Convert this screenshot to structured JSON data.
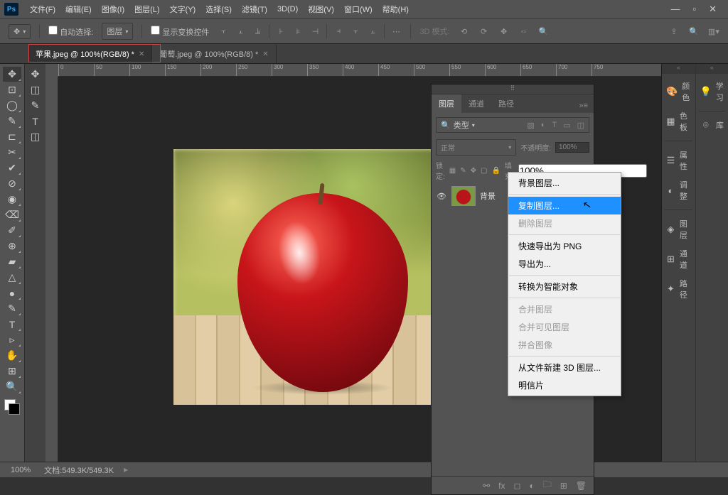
{
  "app": {
    "id": "Ps"
  },
  "menu": [
    "文件(F)",
    "编辑(E)",
    "图像(I)",
    "图层(L)",
    "文字(Y)",
    "选择(S)",
    "滤镜(T)",
    "3D(D)",
    "视图(V)",
    "窗口(W)",
    "帮助(H)"
  ],
  "options": {
    "auto_select_cb": "自动选择:",
    "target": "图层",
    "show_transform": "显示变换控件",
    "mode_3d": "3D 模式:"
  },
  "tabs": [
    {
      "label": "苹果.jpeg @ 100%(RGB/8) *",
      "active": true
    },
    {
      "label": "葡萄.jpeg @ 100%(RGB/8) *",
      "active": false
    }
  ],
  "ruler_marks": [
    "0",
    "50",
    "100",
    "150",
    "200",
    "250",
    "300",
    "350",
    "400",
    "450",
    "500",
    "550",
    "600",
    "650",
    "700",
    "750"
  ],
  "layers_panel": {
    "tabs": [
      "图层",
      "通道",
      "路径"
    ],
    "type_filter": "类型",
    "blend_mode": "正常",
    "opacity_label": "不透明度:",
    "opacity_value": "100%",
    "lock_label": "锁定:",
    "fill_label": "填充:",
    "fill_value": "100%",
    "layer": {
      "name": "背景"
    }
  },
  "context_menu": [
    {
      "label": "背景图层...",
      "state": "normal"
    },
    {
      "sep": true
    },
    {
      "label": "复制图层...",
      "state": "hover"
    },
    {
      "label": "删除图层",
      "state": "disabled"
    },
    {
      "sep": true
    },
    {
      "label": "快速导出为 PNG",
      "state": "normal"
    },
    {
      "label": "导出为...",
      "state": "normal"
    },
    {
      "sep": true
    },
    {
      "label": "转换为智能对象",
      "state": "normal"
    },
    {
      "sep": true
    },
    {
      "label": "合并图层",
      "state": "disabled"
    },
    {
      "label": "合并可见图层",
      "state": "disabled"
    },
    {
      "label": "拼合图像",
      "state": "disabled"
    },
    {
      "sep": true
    },
    {
      "label": "从文件新建 3D 图层...",
      "state": "normal"
    },
    {
      "label": "明信片",
      "state": "normal"
    }
  ],
  "right_strip": {
    "left": [
      {
        "icon": "🎨",
        "label": "颜色"
      },
      {
        "icon": "▦",
        "label": "色板"
      },
      {
        "sep": true
      },
      {
        "icon": "☰",
        "label": "属性"
      },
      {
        "icon": "◐",
        "label": "调整"
      },
      {
        "sep": true
      },
      {
        "icon": "◈",
        "label": "图层"
      },
      {
        "icon": "⊞",
        "label": "通道"
      },
      {
        "icon": "✦",
        "label": "路径"
      }
    ],
    "right": [
      {
        "icon": "💡",
        "label": "学习"
      },
      {
        "sep": true
      },
      {
        "icon": "⌾",
        "label": "库"
      }
    ]
  },
  "status": {
    "zoom": "100%",
    "doc": "文档:549.3K/549.3K"
  },
  "win": {
    "min": "—",
    "max": "▫",
    "close": "✕"
  },
  "tool_icons_left": [
    "✥",
    "⊡",
    "◯",
    "✎",
    "⊏",
    "✂",
    "✔",
    "⊘",
    "◉",
    "⌫",
    "✐",
    "⊕",
    "▰",
    "△",
    "●",
    "✎",
    "T",
    "▹",
    "✋",
    "⊞",
    "🔍"
  ],
  "tool_icons_alt": [
    "✥",
    "◫",
    "✎",
    "T",
    "◫"
  ]
}
